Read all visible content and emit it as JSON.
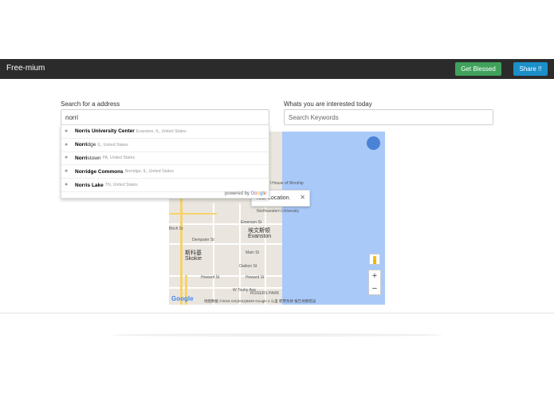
{
  "navbar": {
    "brand": "Free-mium",
    "get_blessed": "Get Blessed",
    "share": "Share !!"
  },
  "search": {
    "address_label": "Search for a address",
    "address_value": "norri",
    "interest_label": "Whats you are interested today",
    "interest_placeholder": "Search Keywords"
  },
  "autocomplete": {
    "items": [
      {
        "match": "Norri",
        "rest": "s University Center",
        "secondary": "Evanston, IL, United States"
      },
      {
        "match": "Norri",
        "rest": "dge",
        "secondary": "IL, United States"
      },
      {
        "match": "Norri",
        "rest": "stown",
        "secondary": "PA, United States"
      },
      {
        "match": "Norri",
        "rest": "dge Commons",
        "secondary": "Norridge, IL, United States"
      },
      {
        "match": "Norri",
        "rest": "s Lake",
        "secondary": "TN, United States"
      }
    ],
    "powered_by": "powered by",
    "google": [
      "G",
      "o",
      "o",
      "g",
      "l",
      "e"
    ]
  },
  "map": {
    "info_text": "Your Location.",
    "labels": {
      "bahai": "Baha'i House of Worship",
      "northwestern": "Northwestern University",
      "emerson": "Emerson St",
      "evanston_cn": "埃文斯顿",
      "evanston": "Evanston",
      "skokie_cn": "斯科基",
      "skokie": "Skokie",
      "dempster": "Dempster St",
      "main": "Main St",
      "oakton": "Oakton St",
      "howard": "Howard St",
      "touhy": "W Touhy Ave",
      "rogers": "ROGERS PARK",
      "birch": "Birch St"
    },
    "footer": "地图数据 ©2015 GS(2011)6020 Google   2 公里     使用条款   报告地图错误",
    "google_logo": "Google"
  },
  "colors": {
    "navbar": "#2b2b2b",
    "get_blessed": "#3fa15b",
    "share": "#1a8fc9",
    "water": "#a9c9f9"
  }
}
